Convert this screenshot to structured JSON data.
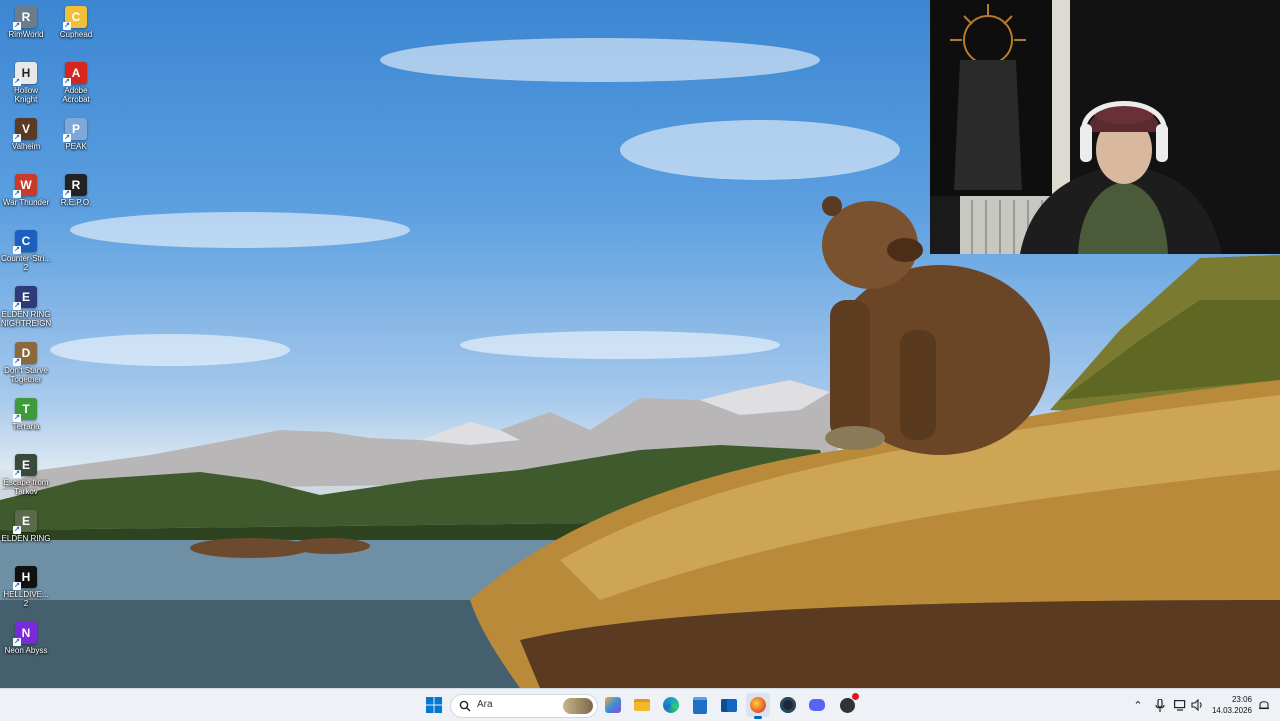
{
  "desktop": {
    "icons": [
      {
        "name": "rimworld",
        "label": "RimWorld",
        "color": "#6b7c8c",
        "glyph": "R"
      },
      {
        "name": "cuphead",
        "label": "Cuphead",
        "color": "#f0c03a",
        "glyph": "C"
      },
      {
        "name": "hollow-knight",
        "label": "Hollow\nKnight",
        "color": "#e8e8e8",
        "glyph": "H"
      },
      {
        "name": "adobe-acrobat",
        "label": "Adobe\nAcrobat",
        "color": "#d7261e",
        "glyph": "A"
      },
      {
        "name": "valheim",
        "label": "Valheim",
        "color": "#5a3a24",
        "glyph": "V"
      },
      {
        "name": "peak",
        "label": "PEAK",
        "color": "#7fa8d8",
        "glyph": "P"
      },
      {
        "name": "war-thunder",
        "label": "War Thunder",
        "color": "#c83a2a",
        "glyph": "W"
      },
      {
        "name": "repo",
        "label": "R.E.P.O.",
        "color": "#222222",
        "glyph": "R"
      },
      {
        "name": "counter-strike-2",
        "label": "Counter-Stri...\n2",
        "color": "#1d5fbf",
        "glyph": "C"
      },
      {
        "name": "elden-ring-nightreign",
        "label": "ELDEN RING\nNIGHTREIGN",
        "color": "#2f3b78",
        "glyph": "E"
      },
      {
        "name": "dont-starve-together",
        "label": "Don't Starve\nTogether",
        "color": "#8a6a3c",
        "glyph": "D"
      },
      {
        "name": "terraria",
        "label": "Terraria",
        "color": "#3e9a3a",
        "glyph": "T"
      },
      {
        "name": "escape-from-tarkov",
        "label": "Escape from\nTarkov",
        "color": "#3a4a3a",
        "glyph": "E"
      },
      {
        "name": "elden-ring",
        "label": "ELDEN RING",
        "color": "#5a6a4a",
        "glyph": "E"
      },
      {
        "name": "helldivers-2",
        "label": "HELLDIVE...\n2",
        "color": "#111111",
        "glyph": "H"
      },
      {
        "name": "neon-abyss",
        "label": "Neon Abyss",
        "color": "#7a2ad8",
        "glyph": "N"
      }
    ]
  },
  "taskbar": {
    "search_placeholder": "Ara",
    "pinned": [
      {
        "name": "widgets",
        "icon": "widgets-icon",
        "color": "#3a8fd8"
      },
      {
        "name": "file-explorer",
        "icon": "folder-icon",
        "color": "#f2b92c"
      },
      {
        "name": "edge",
        "icon": "edge-icon",
        "color": "#1aa0c8"
      },
      {
        "name": "store",
        "icon": "store-icon",
        "color": "#1f6fc6"
      },
      {
        "name": "outlook",
        "icon": "mail-icon",
        "color": "#0f67c3"
      },
      {
        "name": "firefox",
        "icon": "firefox-icon",
        "color": "#e8622a"
      },
      {
        "name": "steam",
        "icon": "steam-icon",
        "color": "#1b2838"
      },
      {
        "name": "discord",
        "icon": "discord-icon",
        "color": "#5865f2"
      },
      {
        "name": "app",
        "icon": "app-icon",
        "color": "#333333"
      }
    ],
    "clock": {
      "time": "23:06",
      "date": "14.03.2026"
    }
  },
  "colors": {
    "accent": "#0067c0",
    "taskbar_bg": "#eef1f6"
  }
}
